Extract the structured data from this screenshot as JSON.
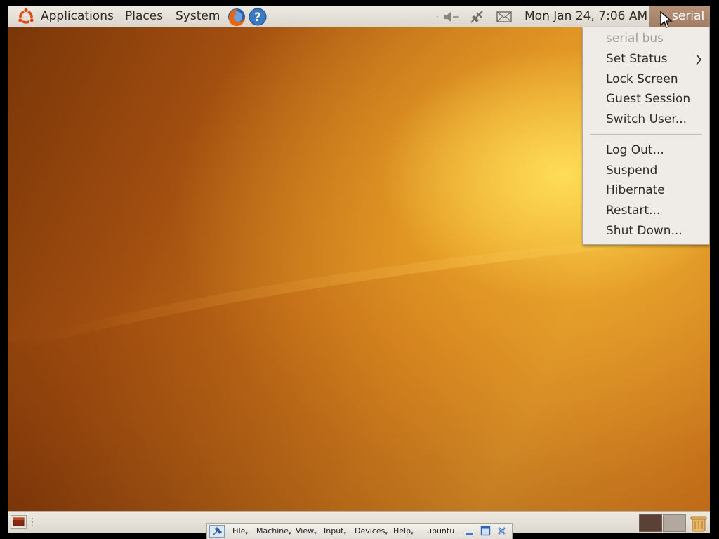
{
  "top_panel": {
    "menus": [
      "Applications",
      "Places",
      "System"
    ],
    "clock": "Mon Jan 24,  7:06 AM",
    "user": "serial"
  },
  "user_menu": {
    "header": "serial bus",
    "items": [
      "Set Status",
      "Lock Screen",
      "Guest Session",
      "Switch User...",
      "Log Out...",
      "Suspend",
      "Hibernate",
      "Restart...",
      "Shut Down..."
    ]
  },
  "vbox_bar": {
    "menus": [
      "File",
      "Machine",
      "View",
      "Input",
      "Devices",
      "Help"
    ],
    "title": "ubuntu"
  },
  "colors": {
    "panel": "#dcd7ce",
    "user_button": "#9f7c64",
    "wallpaper_dark": "#7a3608",
    "wallpaper_light": "#ffe05a"
  },
  "icons": [
    "ubuntu-logo-icon",
    "firefox-icon",
    "help-icon",
    "volume-icon",
    "network-icon",
    "mail-icon",
    "submenu-arrow-icon",
    "show-desktop-icon",
    "trash-icon",
    "pin-icon",
    "minimize-icon",
    "restore-icon",
    "close-icon"
  ]
}
